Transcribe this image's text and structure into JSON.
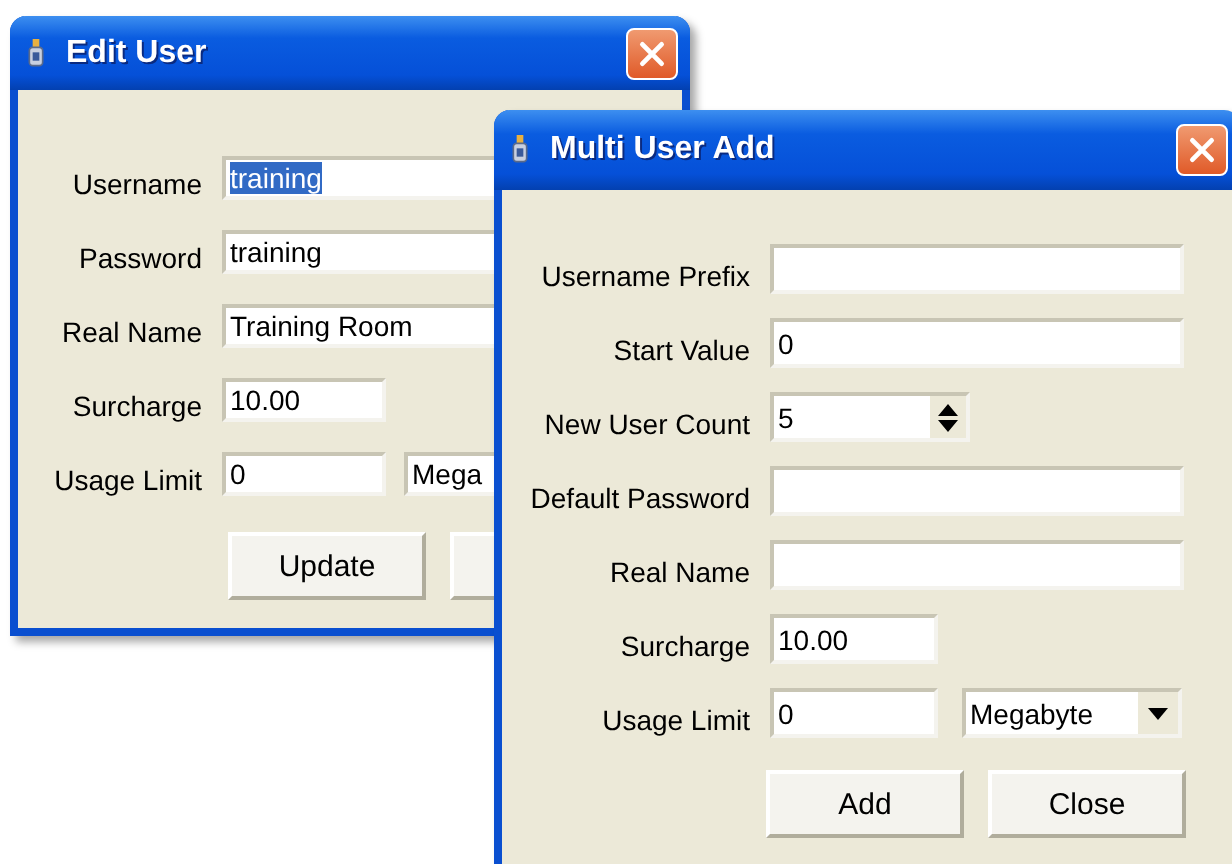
{
  "windows": [
    {
      "title": "Edit User",
      "rows": [
        {
          "label": "Username",
          "fields": [
            {
              "kind": "text",
              "value": "training",
              "selected": true
            }
          ]
        },
        {
          "label": "Password",
          "fields": [
            {
              "kind": "text",
              "value": "training",
              "selected": false
            }
          ]
        },
        {
          "label": "Real Name",
          "fields": [
            {
              "kind": "text",
              "value": "Training Room",
              "selected": false
            }
          ]
        },
        {
          "label": "Surcharge",
          "fields": [
            {
              "kind": "number",
              "value": "10.00",
              "selected": false
            }
          ]
        },
        {
          "label": "Usage Limit",
          "fields": [
            {
              "kind": "number",
              "value": "0",
              "selected": false
            },
            {
              "kind": "select",
              "value": "Mega"
            }
          ]
        }
      ],
      "buttons": [
        {
          "kind": "button",
          "label": "Update"
        },
        {
          "kind": "button"
        }
      ]
    },
    {
      "title": "Multi User Add",
      "rows": [
        {
          "label": "Username  Prefix",
          "fields": [
            {
              "kind": "text"
            }
          ]
        },
        {
          "label": "Start Value",
          "fields": [
            {
              "kind": "text",
              "value": "0",
              "selected": false
            }
          ]
        },
        {
          "label": "New User Count",
          "fields": [
            {
              "kind": "spin",
              "value": "5"
            }
          ]
        },
        {
          "label": "Default Password",
          "fields": [
            {
              "kind": "text"
            }
          ]
        },
        {
          "label": "Real Name",
          "fields": [
            {
              "kind": "text"
            }
          ]
        },
        {
          "label": "Surcharge",
          "fields": [
            {
              "kind": "number",
              "value": "10.00",
              "selected": false
            }
          ]
        },
        {
          "label": "Usage Limit",
          "fields": [
            {
              "kind": "number",
              "value": "0",
              "selected": false
            },
            {
              "kind": "select",
              "value": "Megabyte"
            }
          ]
        }
      ],
      "buttons": [
        {
          "kind": "button",
          "label": "Add"
        },
        {
          "kind": "button",
          "label": "Close"
        }
      ]
    }
  ]
}
